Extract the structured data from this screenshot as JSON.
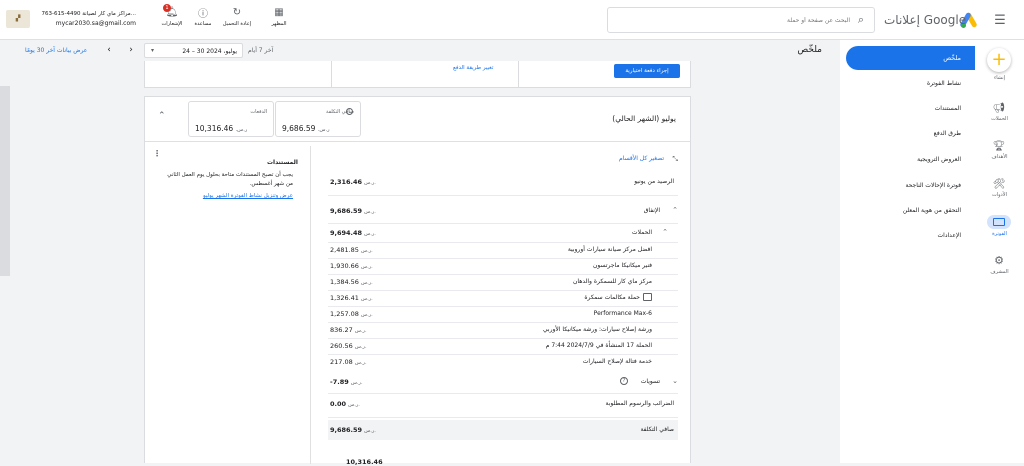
{
  "header": {
    "brand": "إعلانات Google",
    "search_placeholder": "البحث عن صفحة أو حملة",
    "tools": [
      {
        "label": "المظهر",
        "icon": "appearance-icon"
      },
      {
        "label": "إعادة التحميل",
        "icon": "refresh-icon"
      },
      {
        "label": "مساعدة",
        "icon": "help-icon"
      },
      {
        "label": "الإشعارات",
        "icon": "bell-icon",
        "badge": "1"
      }
    ],
    "account_name": "763-615-4490 مراكز ماي كار لصيانة...",
    "account_email": "mycar2030.sa@gmail.com"
  },
  "sidenav": [
    {
      "label": "إنشاء",
      "icon": "plus-icon"
    },
    {
      "label": "الحملات",
      "icon": "campaigns-icon"
    },
    {
      "label": "الأهداف",
      "icon": "trophy-icon"
    },
    {
      "label": "الأدوات",
      "icon": "tools-icon"
    },
    {
      "label": "الفوترة",
      "icon": "billing-icon"
    },
    {
      "label": "المشرف",
      "icon": "admin-icon"
    }
  ],
  "leftnav": [
    "ملخّص",
    "نشاط الفوترة",
    "المستندات",
    "طرق الدفع",
    "العروض الترويجية",
    "فوترة الإحالات الناجحة",
    "التحقق من هوية المعلن",
    "الإعدادات"
  ],
  "page_title": "ملخّص",
  "date": {
    "preset": "آخر 7 أيام",
    "range": "24 – 30 يوليو، 2024",
    "compare": "عرض بيانات آخر 30 يومًا"
  },
  "top_card": {
    "primary_button": "إجراء دفعة اختيارية",
    "link": "تغيير طريقة الدفع"
  },
  "month": {
    "title": "يوليو (الشهر الحالي)",
    "net_label": "صافي التكلفة",
    "net_value": "9,686.59",
    "net_currency": "ر.س.",
    "payments_label": "الدفعات",
    "payments_value": "10,316.46",
    "payments_currency": "ر.س."
  },
  "docs": {
    "title": "المستندات",
    "text": "يجب أن تصبح المستندات متاحة بحلول يوم العمل الثاني من شهر أغسطس.",
    "link": "عرض وتنزيل نشاط الفوترة الشهر يوليو"
  },
  "breakdown": {
    "collapse_all": "تصغير كل الأقسام",
    "currency": "ر.س.",
    "starting_balance_label": "الرصيد من يونيو",
    "starting_balance": "2,316.46",
    "spend_label": "الإنفاق",
    "spend": "9,686.59",
    "campaigns_label": "الحملات",
    "campaigns": "9,694.48",
    "campaign_rows": [
      {
        "name": "افضل مركز صيانة سيارات أوروبية",
        "value": "2,481.85"
      },
      {
        "name": "فنير ميكانيكا ماجرتسون",
        "value": "1,930.66"
      },
      {
        "name": "مركز ماي كار للسمكرة والدهان",
        "value": "1,384.56"
      },
      {
        "name": "حملة مكالمات سمكرة",
        "value": "1,326.41"
      },
      {
        "name": "Performance Max-6",
        "value": "1,257.08"
      },
      {
        "name": "ورشة إصلاح سيارات: ورشة ميكانيكا الأوربي",
        "value": "836.27"
      },
      {
        "name": "الحملة 17 المنشأة في 2024/7/9 7:44 م",
        "value": "260.56"
      },
      {
        "name": "خدمة فتالة لإصلاح السيارات",
        "value": "217.08"
      }
    ],
    "adjustments_label": "تسويات",
    "adjustments": "-7.89",
    "taxes_label": "الضرائب والرسوم المطلوبة",
    "taxes": "0.00",
    "net_label": "صافي التكلفة",
    "net": "9,686.59",
    "bottom_value": "10,316.46"
  }
}
